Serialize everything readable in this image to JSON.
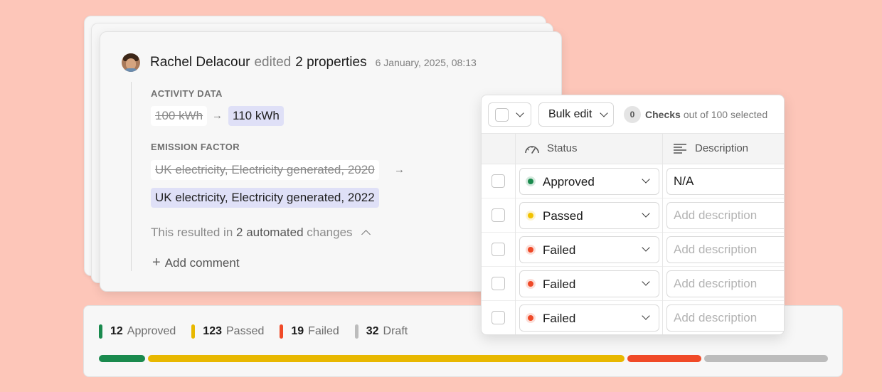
{
  "activity": {
    "user_name": "Rachel Delacour",
    "verb": "edited",
    "properties": "2 properties",
    "timestamp": "6 January, 2025, 08:13",
    "activity_label": "ACTIVITY DATA",
    "activity_old": "100 kWh",
    "activity_new": "110 kWh",
    "emission_label": "EMISSION FACTOR",
    "emission_old": "UK electricity, Electricity generated, 2020",
    "emission_new": "UK electricity, Electricity generated, 2022",
    "result_prefix": "This resulted in",
    "result_count": "2 automated",
    "result_suffix": "changes",
    "add_comment": "Add comment",
    "arrow": "→"
  },
  "table": {
    "bulk_edit": "Bulk edit",
    "checks_count": "0",
    "checks_label": "Checks",
    "checks_suffix": "out of 100 selected",
    "col_status": "Status",
    "col_description": "Description",
    "rows": [
      {
        "status": "Approved",
        "status_color": "#1a8a4e",
        "description": "N/A",
        "placeholder": ""
      },
      {
        "status": "Passed",
        "status_color": "#f2c200",
        "description": "",
        "placeholder": "Add description"
      },
      {
        "status": "Failed",
        "status_color": "#f04a28",
        "description": "",
        "placeholder": "Add description"
      },
      {
        "status": "Failed",
        "status_color": "#f04a28",
        "description": "",
        "placeholder": "Add description"
      },
      {
        "status": "Failed",
        "status_color": "#f04a28",
        "description": "",
        "placeholder": "Add description"
      }
    ]
  },
  "summary": {
    "items": [
      {
        "count": "12",
        "label": "Approved",
        "color": "#1a8a4e",
        "value": 12
      },
      {
        "count": "123",
        "label": "Passed",
        "color": "#e8b800",
        "value": 123
      },
      {
        "count": "19",
        "label": "Failed",
        "color": "#f04a28",
        "value": 19
      },
      {
        "count": "32",
        "label": "Draft",
        "color": "#bcbcbc",
        "value": 32
      }
    ]
  }
}
